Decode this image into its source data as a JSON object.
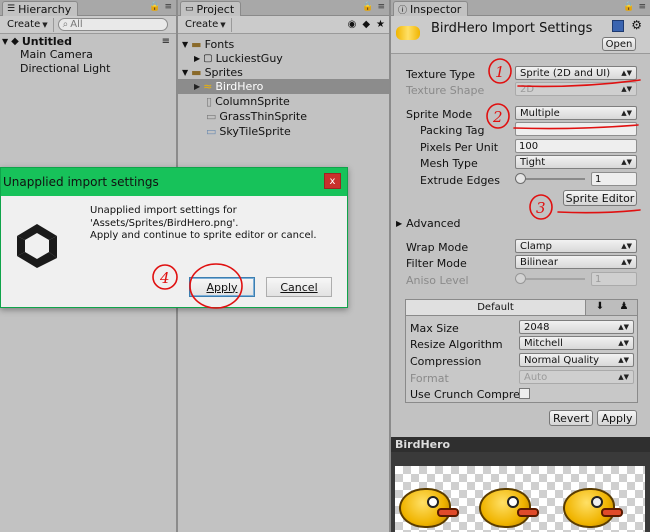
{
  "hierarchy": {
    "tab": "Hierarchy",
    "create_label": "Create",
    "search_placeholder": "All",
    "scene": "Untitled",
    "items": [
      "Main Camera",
      "Directional Light"
    ]
  },
  "project": {
    "tab": "Project",
    "create_label": "Create",
    "tree": [
      {
        "label": "Fonts",
        "kind": "folder"
      },
      {
        "label": "LuckiestGuy",
        "kind": "font"
      },
      {
        "label": "Sprites",
        "kind": "folder"
      },
      {
        "label": "BirdHero",
        "kind": "sprite",
        "selected": true
      },
      {
        "label": "ColumnSprite",
        "kind": "sprite"
      },
      {
        "label": "GrassThinSprite",
        "kind": "sprite"
      },
      {
        "label": "SkyTileSprite",
        "kind": "sprite"
      }
    ]
  },
  "inspector": {
    "tab": "Inspector",
    "header_title": "BirdHero Import Settings",
    "open_label": "Open",
    "texture_type_label": "Texture Type",
    "texture_type_value": "Sprite (2D and UI)",
    "texture_shape_label": "Texture Shape",
    "texture_shape_value": "2D",
    "sprite_mode_label": "Sprite Mode",
    "sprite_mode_value": "Multiple",
    "packing_tag_label": "Packing Tag",
    "packing_tag_value": "",
    "ppu_label": "Pixels Per Unit",
    "ppu_value": "100",
    "mesh_type_label": "Mesh Type",
    "mesh_type_value": "Tight",
    "extrude_label": "Extrude Edges",
    "extrude_value": "1",
    "extrude_fraction": 0.0,
    "sprite_editor_label": "Sprite Editor",
    "advanced_label": "Advanced",
    "wrap_mode_label": "Wrap Mode",
    "wrap_mode_value": "Clamp",
    "filter_mode_label": "Filter Mode",
    "filter_mode_value": "Bilinear",
    "aniso_label": "Aniso Level",
    "aniso_value": "1",
    "aniso_fraction": 0.0,
    "platform_tab": "Default",
    "max_size_label": "Max Size",
    "max_size_value": "2048",
    "resize_label": "Resize Algorithm",
    "resize_value": "Mitchell",
    "compression_label": "Compression",
    "compression_value": "Normal Quality",
    "format_label": "Format",
    "format_value": "Auto",
    "crunch_label": "Use Crunch Compre",
    "revert_label": "Revert",
    "apply_label": "Apply",
    "preview_title": "BirdHero"
  },
  "dialog": {
    "title": "Unapplied import settings",
    "close": "x",
    "line1": "Unapplied import settings for",
    "line2": "'Assets/Sprites/BirdHero.png'.",
    "line3": "Apply and continue to sprite editor or cancel.",
    "apply_label": "Apply",
    "cancel_label": "Cancel"
  },
  "annotations": {
    "n1": "1",
    "n2": "2",
    "n3": "3",
    "n4": "4",
    "color": "#e01010"
  },
  "colors": {
    "dialog_title_bg": "#17c25a",
    "selection": "#3d7ad6",
    "panel_bg": "#c2c2c2"
  }
}
